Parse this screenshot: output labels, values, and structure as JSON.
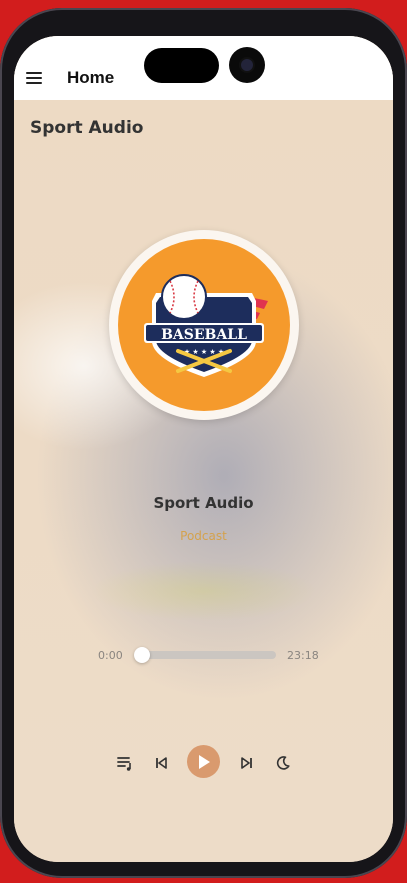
{
  "appbar": {
    "title": "Home",
    "menu_icon": "hamburger-menu-icon"
  },
  "section": {
    "title": "Sport Audio"
  },
  "cover": {
    "logo_text": "BASEBALL",
    "accent": "#f59a2c"
  },
  "track": {
    "title": "Sport Audio",
    "subtitle": "Podcast",
    "subtitle_color": "#d4a24d"
  },
  "progress": {
    "current": "0:00",
    "total": "23:18",
    "fraction": 0.0
  },
  "controls": {
    "playlist_icon": "playlist-icon",
    "previous_icon": "skip-previous-icon",
    "play_icon": "play-icon",
    "next_icon": "skip-next-icon",
    "sleep_icon": "moon-icon",
    "play_color": "#d99a6e"
  }
}
